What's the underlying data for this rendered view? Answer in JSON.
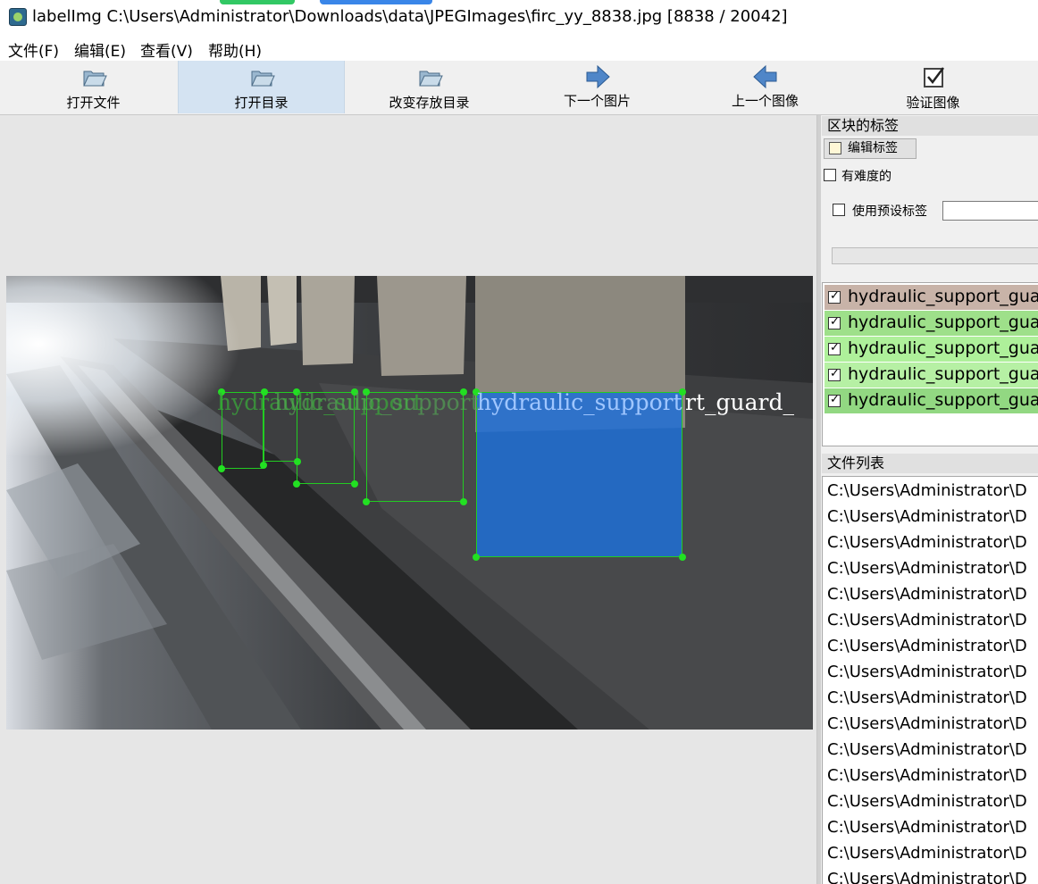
{
  "window": {
    "title": "labelImg C:\\Users\\Administrator\\Downloads\\data\\JPEGImages\\firc_yy_8838.jpg [8838 / 20042]",
    "app_icon": "labelimg-app-icon"
  },
  "menu": [
    "文件(F)",
    "编辑(E)",
    "查看(V)",
    "帮助(H)"
  ],
  "toolbar": [
    {
      "label": "打开文件",
      "icon": "open-file-icon",
      "active": false
    },
    {
      "label": "打开目录",
      "icon": "open-dir-icon",
      "active": true
    },
    {
      "label": "改变存放目录",
      "icon": "change-save-dir-icon",
      "active": false
    },
    {
      "label": "下一个图片",
      "icon": "next-image-icon",
      "active": false
    },
    {
      "label": "上一个图像",
      "icon": "prev-image-icon",
      "active": false
    },
    {
      "label": "验证图像",
      "icon": "verify-image-icon",
      "active": false
    }
  ],
  "canvas": {
    "visible_labels": [
      "hydraulic_support",
      "rt_guard_"
    ]
  },
  "labels_dock": {
    "title": "区块的标签",
    "edit_button": "编辑标签",
    "difficult_label": "有难度的",
    "difficult_checked": false,
    "use_default_label": "使用预设标签",
    "use_default_checked": false,
    "default_label_value": "",
    "items": [
      {
        "text": "hydraulic_support_gua",
        "checked": true,
        "color": "#c8b3a8"
      },
      {
        "text": "hydraulic_support_gua",
        "checked": true,
        "color": "#9ee08a"
      },
      {
        "text": "hydraulic_support_gua",
        "checked": true,
        "color": "#aef09a"
      },
      {
        "text": "hydraulic_support_gua",
        "checked": true,
        "color": "#b6f0a4"
      },
      {
        "text": "hydraulic_support_gua",
        "checked": true,
        "color": "#92d882"
      }
    ]
  },
  "file_dock": {
    "title": "文件列表",
    "items": [
      "C:\\Users\\Administrator\\D",
      "C:\\Users\\Administrator\\D",
      "C:\\Users\\Administrator\\D",
      "C:\\Users\\Administrator\\D",
      "C:\\Users\\Administrator\\D",
      "C:\\Users\\Administrator\\D",
      "C:\\Users\\Administrator\\D",
      "C:\\Users\\Administrator\\D",
      "C:\\Users\\Administrator\\D",
      "C:\\Users\\Administrator\\D",
      "C:\\Users\\Administrator\\D",
      "C:\\Users\\Administrator\\D",
      "C:\\Users\\Administrator\\D",
      "C:\\Users\\Administrator\\D",
      "C:\\Users\\Administrator\\D",
      "C:\\Users\\Administrator\\D"
    ]
  },
  "colors": {
    "selected_box_fill": "#1f6fd6",
    "box_outline": "#22cc22",
    "toolbar_active": "#d4e3f2"
  }
}
